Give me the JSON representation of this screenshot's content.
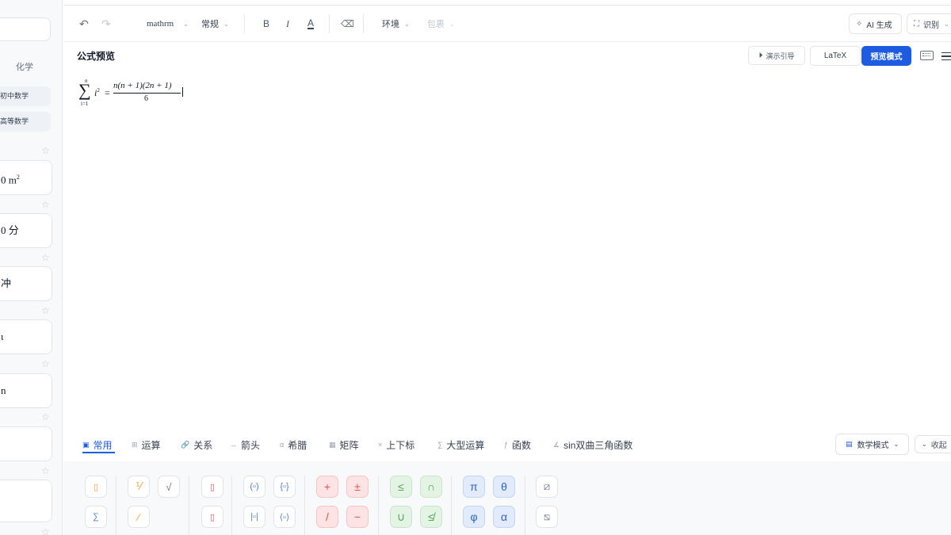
{
  "sidebar": {
    "tab_label": "化学",
    "chips": [
      "初中数学",
      "高等数学"
    ],
    "cards": [
      {
        "text": "0 m",
        "sup": "2"
      },
      {
        "text": "0 分",
        "sup": ""
      },
      {
        "text": "冲",
        "sup": ""
      },
      {
        "text": "ι",
        "sup": ""
      },
      {
        "text": "n",
        "sup": ""
      },
      {
        "text": "",
        "sup": ""
      },
      {
        "text": "",
        "sup": ""
      }
    ],
    "star_glyph": "☆"
  },
  "toolbar": {
    "undo_glyph": "↶",
    "redo_glyph": "↷",
    "font_value": "mathrm",
    "style_value": "常规",
    "bold_glyph": "B",
    "italic_glyph": "I",
    "color_glyph": "A",
    "eraser_glyph": "⌫",
    "env_label": "环境",
    "wrap_label": "包裹",
    "ai_label": "AI 生成",
    "ocr_label": "识别",
    "chevron": "⌄"
  },
  "preview": {
    "title": "公式预览",
    "demo_label": "演示引导",
    "latex_label": "LaTeX",
    "preview_mode_label": "预览模式"
  },
  "formula": {
    "sum_symbol": "∑",
    "upper": "n",
    "lower": "i=1",
    "term": "i",
    "term_exp": "2",
    "equals": "=",
    "numerator": "n(n + 1)(2n + 1)",
    "denominator": "6"
  },
  "symbol_tabs": [
    {
      "label": "常用",
      "icon": "▣",
      "active": true
    },
    {
      "label": "运算",
      "icon": "⊞",
      "active": false
    },
    {
      "label": "关系",
      "icon": "🔗",
      "active": false
    },
    {
      "label": "箭头",
      "icon": "↔",
      "active": false
    },
    {
      "label": "希腊",
      "icon": "α",
      "active": false
    },
    {
      "label": "矩阵",
      "icon": "▦",
      "active": false
    },
    {
      "label": "上下标",
      "icon": "×",
      "active": false
    },
    {
      "label": "大型运算",
      "icon": "∑",
      "active": false
    },
    {
      "label": "函数",
      "icon": "ƒ",
      "active": false
    },
    {
      "label": "sin双曲三角函数",
      "icon": "∡",
      "active": false
    }
  ],
  "mode_select": {
    "label": "数学模式",
    "icon": "▤"
  },
  "collapse_label": "收起",
  "symbols": {
    "operators": [
      "+",
      "±",
      "/",
      "−"
    ],
    "relations": [
      "≤",
      "∩",
      "∪",
      "≰"
    ],
    "greek": [
      "π",
      "θ",
      "φ",
      "α"
    ]
  },
  "colors": {
    "accent": "#1d5be0",
    "red_tile": "#fde3e3",
    "green_tile": "#e3f3e4",
    "blue_tile": "#e1ebfb"
  }
}
